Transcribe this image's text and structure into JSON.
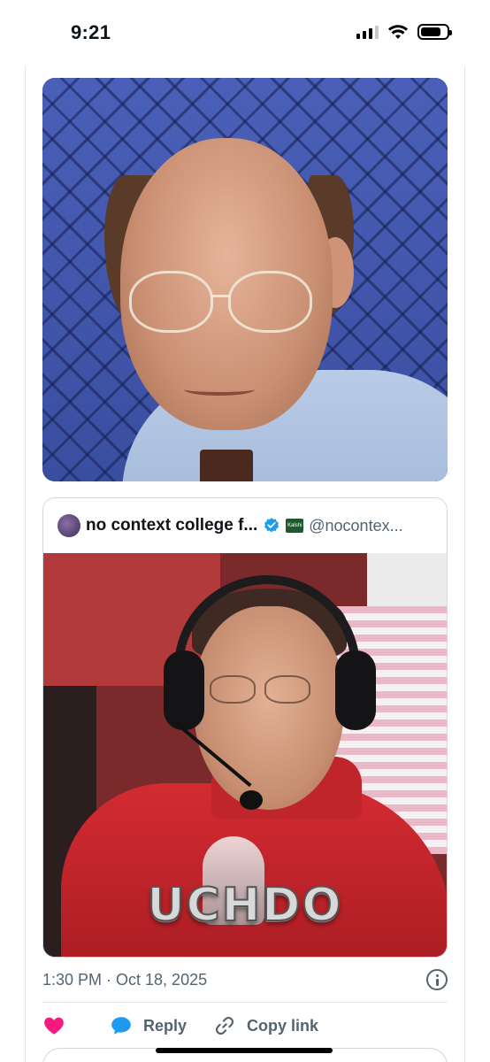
{
  "status_bar": {
    "time": "9:21"
  },
  "quoted_post": {
    "author_name": "no context college f...",
    "author_handle": "@nocontex...",
    "affiliation_badge": "Kalshi",
    "media_overlay_text": "UCHDO"
  },
  "post_meta": {
    "timestamp": "1:30 PM · Oct 18, 2025"
  },
  "actions": {
    "like_label": "",
    "reply_label": "Reply",
    "copy_link_label": "Copy link"
  },
  "colors": {
    "like": "#f91880",
    "reply": "#1d9bf0",
    "muted_text": "#536471",
    "verified": "#1d9bf0"
  },
  "icons": {
    "like": "heart-icon",
    "reply": "speech-bubble-icon",
    "copy_link": "link-icon",
    "info": "info-icon",
    "verified": "verified-badge-icon"
  }
}
